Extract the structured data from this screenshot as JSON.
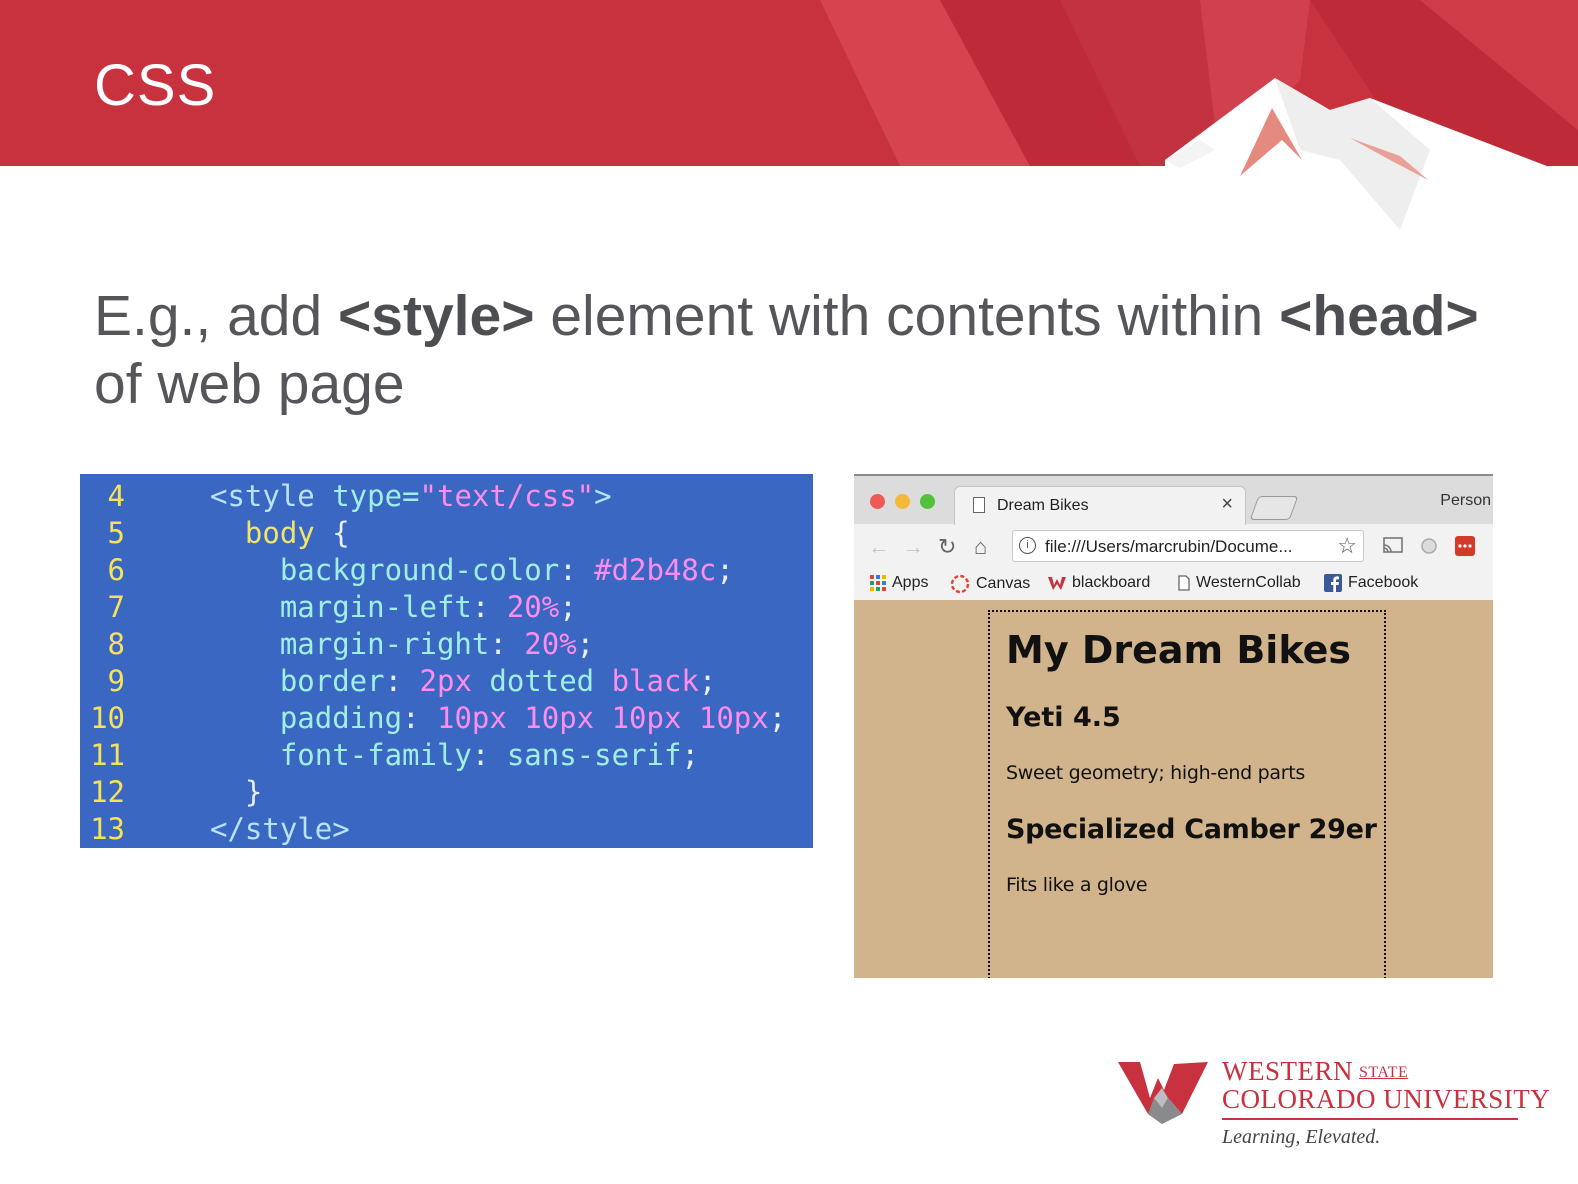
{
  "slide": {
    "title": "CSS",
    "heading_parts": [
      "E.g., add ",
      "<style>",
      " element with contents within ",
      "<head>",
      " of web page"
    ]
  },
  "code": {
    "lines": [
      {
        "num": "4",
        "parts": [
          {
            "t": "<style ",
            "c": "tag"
          },
          {
            "t": "type=",
            "c": "prop"
          },
          {
            "t": "\"text/css\"",
            "c": "str"
          },
          {
            "t": ">",
            "c": "tag"
          }
        ]
      },
      {
        "num": "5",
        "parts": [
          {
            "t": "  body ",
            "c": "kw"
          },
          {
            "t": "{",
            "c": "plain"
          }
        ]
      },
      {
        "num": "6",
        "parts": [
          {
            "t": "    background-color",
            "c": "prop"
          },
          {
            "t": ": ",
            "c": "plain"
          },
          {
            "t": "#d2b48c",
            "c": "val"
          },
          {
            "t": ";",
            "c": "plain"
          }
        ]
      },
      {
        "num": "7",
        "parts": [
          {
            "t": "    margin-left",
            "c": "prop"
          },
          {
            "t": ": ",
            "c": "plain"
          },
          {
            "t": "20%",
            "c": "val"
          },
          {
            "t": ";",
            "c": "plain"
          }
        ]
      },
      {
        "num": "8",
        "parts": [
          {
            "t": "    margin-right",
            "c": "prop"
          },
          {
            "t": ": ",
            "c": "plain"
          },
          {
            "t": "20%",
            "c": "val"
          },
          {
            "t": ";",
            "c": "plain"
          }
        ]
      },
      {
        "num": "9",
        "parts": [
          {
            "t": "    border",
            "c": "prop"
          },
          {
            "t": ": ",
            "c": "plain"
          },
          {
            "t": "2px ",
            "c": "val"
          },
          {
            "t": "dotted ",
            "c": "prop"
          },
          {
            "t": "black",
            "c": "val"
          },
          {
            "t": ";",
            "c": "plain"
          }
        ]
      },
      {
        "num": "10",
        "parts": [
          {
            "t": "    padding",
            "c": "prop"
          },
          {
            "t": ": ",
            "c": "plain"
          },
          {
            "t": "10px 10px 10px 10px",
            "c": "val"
          },
          {
            "t": ";",
            "c": "plain"
          }
        ]
      },
      {
        "num": "11",
        "parts": [
          {
            "t": "    font-family",
            "c": "prop"
          },
          {
            "t": ": ",
            "c": "plain"
          },
          {
            "t": "sans-serif",
            "c": "prop"
          },
          {
            "t": ";",
            "c": "plain"
          }
        ]
      },
      {
        "num": "12",
        "parts": [
          {
            "t": "  }",
            "c": "plain"
          }
        ]
      },
      {
        "num": "13",
        "parts": [
          {
            "t": "</style>",
            "c": "tag"
          }
        ]
      }
    ]
  },
  "browser": {
    "tab_title": "Dream Bikes",
    "tab_close": "×",
    "profile": "Person",
    "url": "file:///Users/marcrubin/Docume...",
    "bookmarks": [
      "Apps",
      "Canvas",
      "blackboard",
      "WesternCollab",
      "Facebook"
    ],
    "page": {
      "h1": "My Dream Bikes",
      "bike1_title": "Yeti 4.5",
      "bike1_desc": "Sweet geometry; high-end parts",
      "bike2_title": "Specialized Camber 29er",
      "bike2_desc": "Fits like a glove"
    },
    "background_color": "#d2b48c"
  },
  "logo": {
    "line1": "WESTERN",
    "state": "STATE",
    "line2": "COLORADO UNIVERSITY",
    "tagline": "Learning, Elevated."
  },
  "colors": {
    "banner_red": "#c8323f",
    "code_bg": "#3a67c2"
  }
}
